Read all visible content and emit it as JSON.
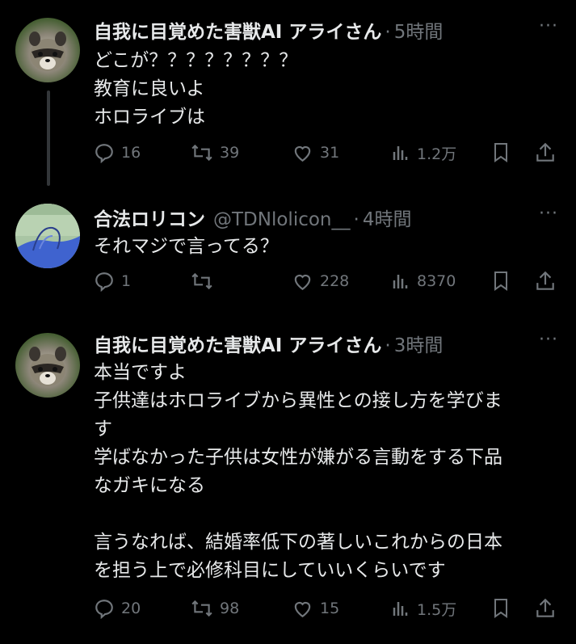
{
  "tweets": [
    {
      "name": "自我に目覚めた害獣AI アライさん",
      "handle": "",
      "time": "5時間",
      "lines": [
        "どこが？？？？？？？？",
        "教育に良いよ",
        "ホロライブは"
      ],
      "replies": "16",
      "retweets": "39",
      "likes": "31",
      "views": "1.2万"
    },
    {
      "name": "合法ロリコン",
      "handle": "@TDNlolicon__",
      "time": "4時間",
      "lines": [
        "それマジで言ってる？"
      ],
      "replies": "1",
      "retweets": "",
      "likes": "228",
      "views": "8370"
    },
    {
      "name": "自我に目覚めた害獣AI アライさん",
      "handle": "",
      "time": "3時間",
      "lines": [
        "本当ですよ",
        "子供達はホロライブから異性との接し方を学びま",
        "す",
        "学ばなかった子供は女性が嫌がる言動をする下品",
        "なガキになる",
        "",
        "言うなれば、結婚率低下の著しいこれからの日本",
        "を担う上で必修科目にしていいくらいです"
      ],
      "replies": "20",
      "retweets": "98",
      "likes": "15",
      "views": "1.5万"
    }
  ],
  "more_label": "···",
  "separator": "·",
  "icons": [
    "reply-icon",
    "retweet-icon",
    "like-icon",
    "views-icon",
    "bookmark-icon",
    "share-icon"
  ]
}
